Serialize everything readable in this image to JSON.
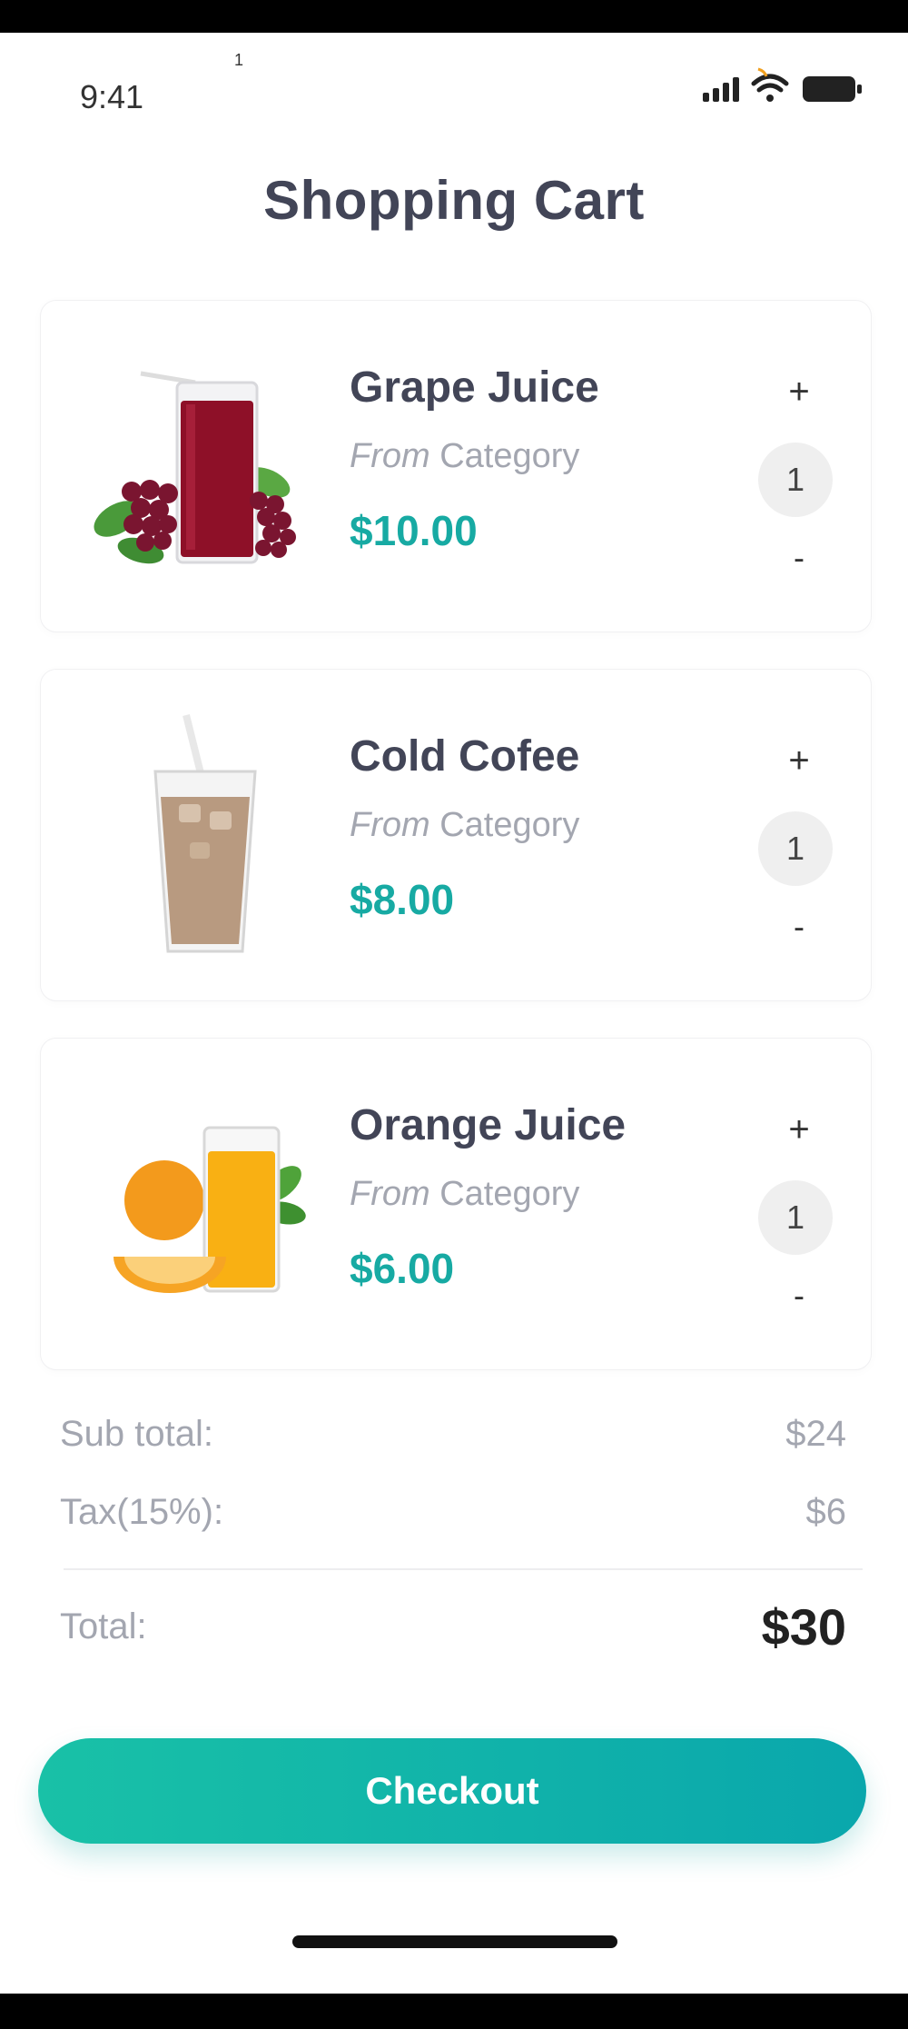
{
  "status_bar": {
    "time": "9:41",
    "indicator": "1",
    "icons": [
      "signal-icon",
      "wifi-icon",
      "battery-icon"
    ]
  },
  "page": {
    "title": "Shopping Cart"
  },
  "cart": {
    "items": [
      {
        "name": "Grape Juice",
        "category_prefix": "From",
        "category": "Category",
        "price": "$10.00",
        "qty_plus": "+",
        "quantity": "1",
        "qty_minus": "-",
        "image": "grape-juice-image"
      },
      {
        "name": "Cold Cofee",
        "category_prefix": "From",
        "category": "Category",
        "price": "$8.00",
        "qty_plus": "+",
        "quantity": "1",
        "qty_minus": "-",
        "image": "cold-coffee-image"
      },
      {
        "name": "Orange Juice",
        "category_prefix": "From",
        "category": "Category",
        "price": "$6.00",
        "qty_plus": "+",
        "quantity": "1",
        "qty_minus": "-",
        "image": "orange-juice-image"
      }
    ]
  },
  "summary": {
    "subtotal_label": "Sub total:",
    "subtotal_value": "$24",
    "tax_label": "Tax(15%):",
    "tax_value": "$6",
    "total_label": "Total:",
    "total_value": "$30"
  },
  "checkout": {
    "label": "Checkout"
  },
  "colors": {
    "accent": "#17aaa3",
    "gradient_start": "#19c1a7",
    "gradient_end": "#0aa7ac",
    "title": "#424557",
    "muted": "#a3a6b0"
  }
}
